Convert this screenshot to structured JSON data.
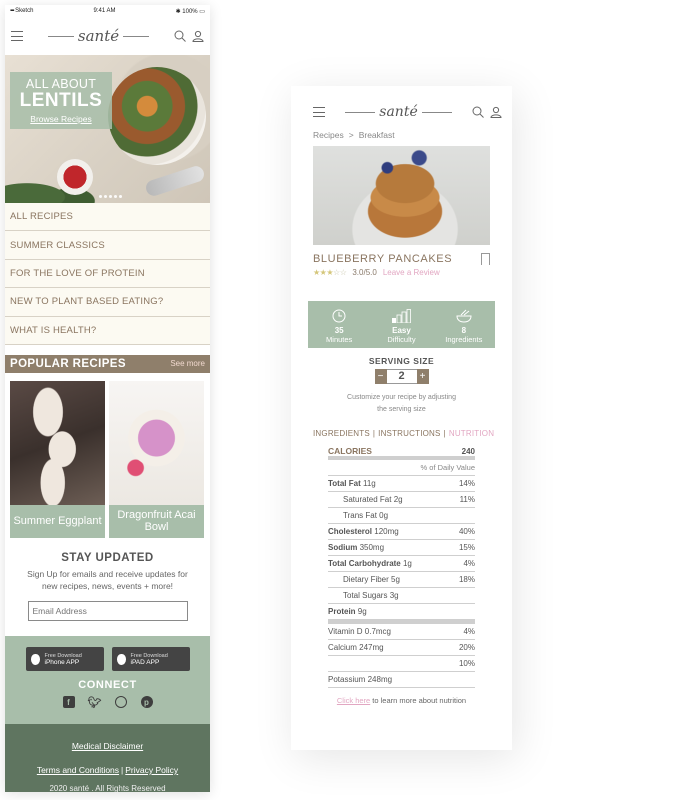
{
  "left": {
    "statusbar": {
      "carrier": "Sketch",
      "time": "9:41 AM",
      "battery": "100%"
    },
    "logo": "santé",
    "hero": {
      "kicker": "ALL ABOUT",
      "headline": "LENTILS",
      "cta": "Browse Recipes"
    },
    "menu": [
      {
        "label": "ALL RECIPES"
      },
      {
        "label": "SUMMER CLASSICS"
      },
      {
        "label": "FOR THE LOVE OF PROTEIN"
      },
      {
        "label": "NEW TO PLANT BASED EATING?"
      },
      {
        "label": "WHAT IS HEALTH?"
      }
    ],
    "popular": {
      "title": "POPULAR RECIPES",
      "see_more": "See more",
      "items": [
        {
          "label": "Summer Eggplant"
        },
        {
          "label": "Dragonfruit Acai Bowl"
        }
      ]
    },
    "stay": {
      "title": "STAY UPDATED",
      "text": "Sign Up for emails and receive updates for new recipes, news, events  + more!",
      "email_placeholder": "Email Address"
    },
    "apps": [
      {
        "top": "Free Download",
        "bottom": "iPhone APP"
      },
      {
        "top": "Free Download",
        "bottom": "iPAD APP"
      }
    ],
    "connect": "CONNECT",
    "footer": {
      "disclaimer": "Medical Disclaimer",
      "terms": "Terms and Conditions",
      "privacy": "Privacy Policy",
      "copyright": "2020 santé . All Rights Reserved"
    }
  },
  "right": {
    "logo": "santé",
    "breadcrumb": {
      "root": "Recipes",
      "current": "Breakfast"
    },
    "recipe": {
      "title": "BLUEBERRY PANCAKES",
      "rating": "3.0/5.0",
      "rating_value": 3.0,
      "review_link": "Leave a Review"
    },
    "stats": [
      {
        "value": "35",
        "label": "Minutes",
        "icon": "clock-icon"
      },
      {
        "value": "Easy",
        "label": "Difficulty",
        "icon": "difficulty-bars-icon"
      },
      {
        "value": "8",
        "label": "Ingredients",
        "icon": "bowl-icon"
      }
    ],
    "serving": {
      "title": "SERVING SIZE",
      "value": "2",
      "minus": "−",
      "plus": "+",
      "note_line1": "Customize your recipe by adjusting",
      "note_line2": "the serving size"
    },
    "tabs": {
      "ingredients": "INGREDIENTS",
      "instructions": "INSTRUCTIONS",
      "nutrition": "NUTRITION",
      "active": "nutrition"
    },
    "nutrition": {
      "calories_label": "CALORIES",
      "calories_value": "240",
      "dv_header": "% of Daily Value",
      "rows": [
        {
          "label": "Total Fat",
          "bold": true,
          "amount": "11g",
          "pct": "14%",
          "indent": false
        },
        {
          "label": "Saturated Fat",
          "bold": false,
          "amount": "2g",
          "pct": "11%",
          "indent": true
        },
        {
          "label": "Trans Fat",
          "bold": false,
          "amount": "0g",
          "pct": "",
          "indent": true
        },
        {
          "label": "Cholesterol",
          "bold": true,
          "amount": "120mg",
          "pct": "40%",
          "indent": false
        },
        {
          "label": "Sodium",
          "bold": true,
          "amount": "350mg",
          "pct": "15%",
          "indent": false
        },
        {
          "label": "Total Carbohydrate",
          "bold": true,
          "amount": "1g",
          "pct": "4%",
          "indent": false
        },
        {
          "label": "Dietary Fiber",
          "bold": false,
          "amount": "5g",
          "pct": "18%",
          "indent": true
        },
        {
          "label": "Total Sugars",
          "bold": false,
          "amount": "3g",
          "pct": "",
          "indent": true
        },
        {
          "label": "Protein",
          "bold": true,
          "amount": "9g",
          "pct": "",
          "indent": false
        }
      ],
      "micros": [
        {
          "label": "Vitamin D",
          "amount": "0.7mcg",
          "pct": "4%"
        },
        {
          "label": "Calcium",
          "amount": "247mg",
          "pct": "20%"
        },
        {
          "label": "",
          "amount": "",
          "pct": "10%"
        },
        {
          "label": "Potassium",
          "amount": "248mg",
          "pct": ""
        }
      ]
    },
    "learn": {
      "link": "Click here",
      "text": " to learn more about nutrition"
    }
  },
  "colors": {
    "sage": "#a8beaa",
    "taupe": "#8f7f6b",
    "pink": "#e2a7c2",
    "footer": "#5f7560",
    "cream": "#fcfaf2"
  }
}
